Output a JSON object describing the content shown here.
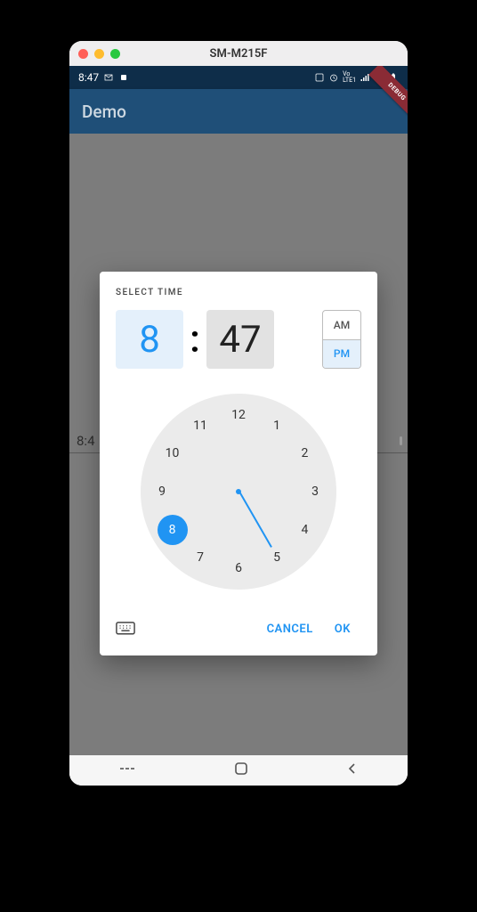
{
  "window": {
    "device_name": "SM-M215F"
  },
  "statusbar": {
    "time": "8:47"
  },
  "appbar": {
    "title": "Demo",
    "debug_ribbon": "DEBUG"
  },
  "body": {
    "field_preview": "8:4"
  },
  "dialog": {
    "label": "SELECT TIME",
    "hour": "8",
    "minute": "47",
    "colon": ":",
    "am": "AM",
    "pm": "PM",
    "period_selected": "PM",
    "clock_numbers": [
      "12",
      "1",
      "2",
      "3",
      "4",
      "5",
      "6",
      "7",
      "8",
      "9",
      "10",
      "11"
    ],
    "selected_hour_index": 8,
    "actions": {
      "cancel": "Cancel",
      "ok": "OK"
    }
  },
  "navbar": {
    "recent": "|||",
    "home": "◻",
    "back": "‹"
  }
}
